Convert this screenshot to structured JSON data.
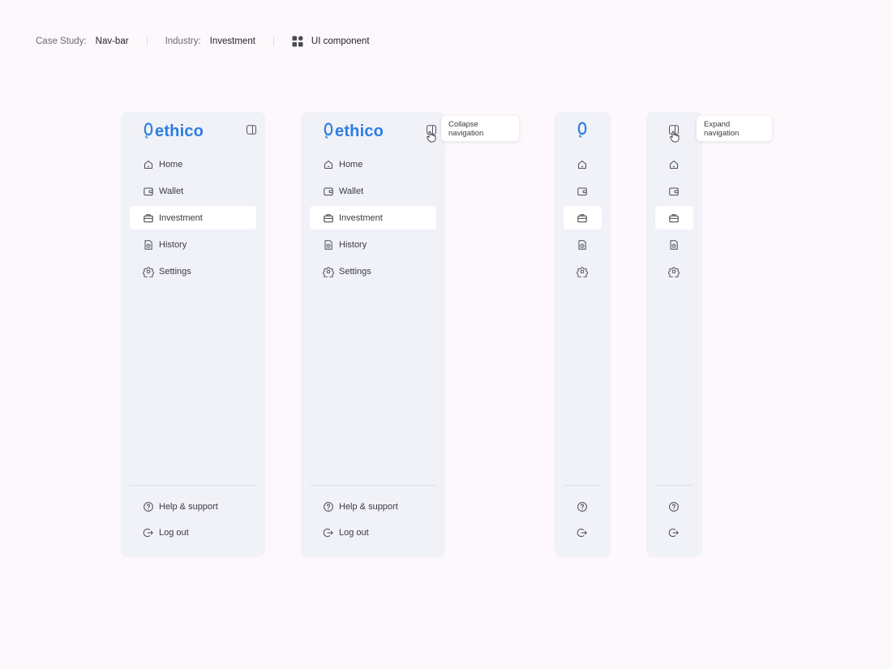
{
  "header": {
    "case_study_label": "Case Study:",
    "case_study_value": "Nav-bar",
    "industry_label": "Industry:",
    "industry_value": "Investment",
    "component_label": "UI component"
  },
  "brand": {
    "name": "ethico",
    "color": "#2a7ee0"
  },
  "nav": {
    "items": [
      {
        "label": "Home",
        "icon": "home-icon"
      },
      {
        "label": "Wallet",
        "icon": "wallet-icon"
      },
      {
        "label": "Investment",
        "icon": "briefcase-icon",
        "active": true
      },
      {
        "label": "History",
        "icon": "history-icon"
      },
      {
        "label": "Settings",
        "icon": "gear-icon"
      }
    ],
    "footer": [
      {
        "label": "Help & support",
        "icon": "help-icon"
      },
      {
        "label": "Log out",
        "icon": "logout-icon"
      }
    ]
  },
  "tooltips": {
    "collapse": "Collapse navigation",
    "expand": "Expand navigation"
  },
  "colors": {
    "background": "#fcf8fc",
    "panel": "#f1f1f8",
    "active_item": "#ffffff",
    "accent": "#2a7ee0"
  }
}
